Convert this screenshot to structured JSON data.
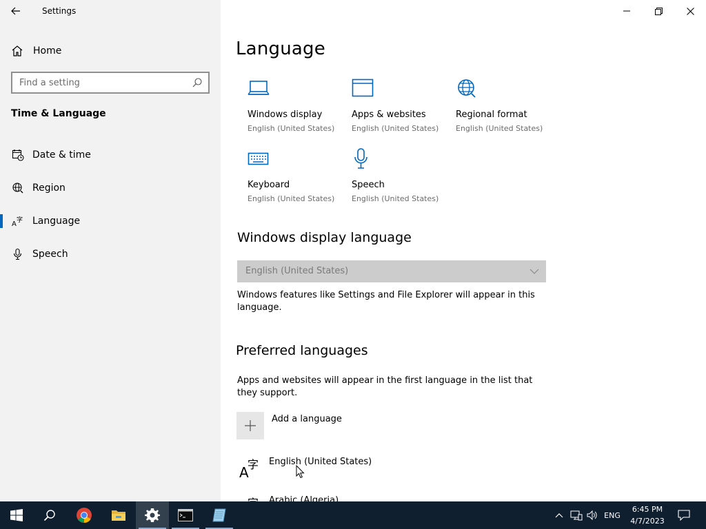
{
  "window": {
    "title": "Settings"
  },
  "sidebar": {
    "home_label": "Home",
    "search_placeholder": "Find a setting",
    "section_title": "Time & Language",
    "items": [
      {
        "label": "Date & time",
        "icon": "calendar-clock-icon"
      },
      {
        "label": "Region",
        "icon": "globe-icon"
      },
      {
        "label": "Language",
        "icon": "language-icon",
        "selected": true
      },
      {
        "label": "Speech",
        "icon": "microphone-icon"
      }
    ]
  },
  "main": {
    "title": "Language",
    "tiles": [
      {
        "name": "Windows display",
        "sub": "English (United States)",
        "icon": "laptop-icon"
      },
      {
        "name": "Apps & websites",
        "sub": "English (United States)",
        "icon": "browser-window-icon"
      },
      {
        "name": "Regional format",
        "sub": "English (United States)",
        "icon": "globe-icon"
      },
      {
        "name": "Keyboard",
        "sub": "English (United States)",
        "icon": "keyboard-icon"
      },
      {
        "name": "Speech",
        "sub": "English (United States)",
        "icon": "microphone-icon"
      }
    ],
    "display_language": {
      "heading": "Windows display language",
      "selected": "English (United States)",
      "description": "Windows features like Settings and File Explorer will appear in this language."
    },
    "preferred": {
      "heading": "Preferred languages",
      "description": "Apps and websites will appear in the first language in the list that they support.",
      "add_label": "Add a language",
      "languages": [
        "English (United States)",
        "Arabic (Algeria)"
      ]
    }
  },
  "taskbar": {
    "apps": [
      "start-icon",
      "search-icon",
      "chrome-icon",
      "file-explorer-icon",
      "settings-icon",
      "terminal-icon",
      "notepad-icon"
    ],
    "tray": {
      "input_language": "ENG",
      "time": "6:45 PM",
      "date": "4/7/2023"
    }
  },
  "colors": {
    "accent": "#0067c0",
    "sidebar_bg": "#f2f2f2",
    "taskbar_bg": "#101f30"
  }
}
